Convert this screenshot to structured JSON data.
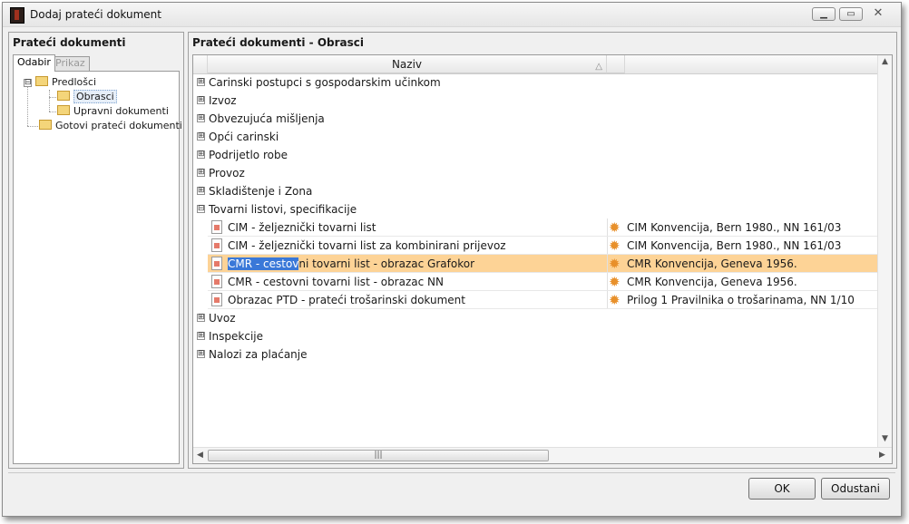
{
  "window": {
    "title": "Dodaj prateći dokument",
    "controls": {
      "minimize": "▁",
      "maximize": "▭",
      "close": "✕"
    }
  },
  "left_panel": {
    "heading": "Prateći dokumenti",
    "tabs": [
      {
        "label": "Odabir",
        "active": true
      },
      {
        "label": "Prikaz",
        "active": false
      }
    ],
    "tree": {
      "root": "Predlošci",
      "children": [
        "Obrasci",
        "Upravni dokumenti"
      ],
      "selected": "Obrasci",
      "second_root": "Gotovi prateći dokumenti"
    }
  },
  "right_panel": {
    "heading": "Prateći dokumenti - Obrasci",
    "grid": {
      "column_header": "Naziv",
      "groups_before": [
        "Carinski postupci s gospodarskim učinkom",
        "Izvoz",
        "Obvezujuća mišljenja",
        "Opći carinski",
        "Podrijetlo robe",
        "Provoz",
        "Skladištenje i Zona"
      ],
      "expanded_group": "Tovarni listovi, specifikacije",
      "rows": [
        {
          "name": "CIM - željeznički tovarni list",
          "ref": "CIM Konvencija, Bern 1980., NN 161/03"
        },
        {
          "name": "CIM - željeznički tovarni list za kombinirani prijevoz",
          "ref": "CIM Konvencija, Bern 1980., NN 161/03"
        },
        {
          "name_highlight": "CMR - cestov",
          "name_rest": "ni tovarni list - obrazac Grafokor",
          "ref": "CMR Konvencija, Geneva 1956.",
          "selected": true
        },
        {
          "name": "CMR - cestovni tovarni list - obrazac NN",
          "ref": "CMR Konvencija, Geneva 1956."
        },
        {
          "name": "Obrazac PTD - prateći trošarinski dokument",
          "ref": "Prilog 1 Pravilnika o trošarinama, NN 1/10"
        }
      ],
      "groups_after": [
        "Uvoz",
        "Inspekcije",
        "Nalozi za plaćanje"
      ]
    }
  },
  "buttons": {
    "ok": "OK",
    "cancel": "Odustani"
  },
  "icons": {
    "app": "app-icon",
    "folder": "folder-icon",
    "document": "document-icon",
    "star": "star-icon",
    "expand": "⊞",
    "collapse": "⊟"
  },
  "colors": {
    "selected_row": "#fdd396",
    "text_highlight": "#3a78d8",
    "star": "#e8902a"
  }
}
